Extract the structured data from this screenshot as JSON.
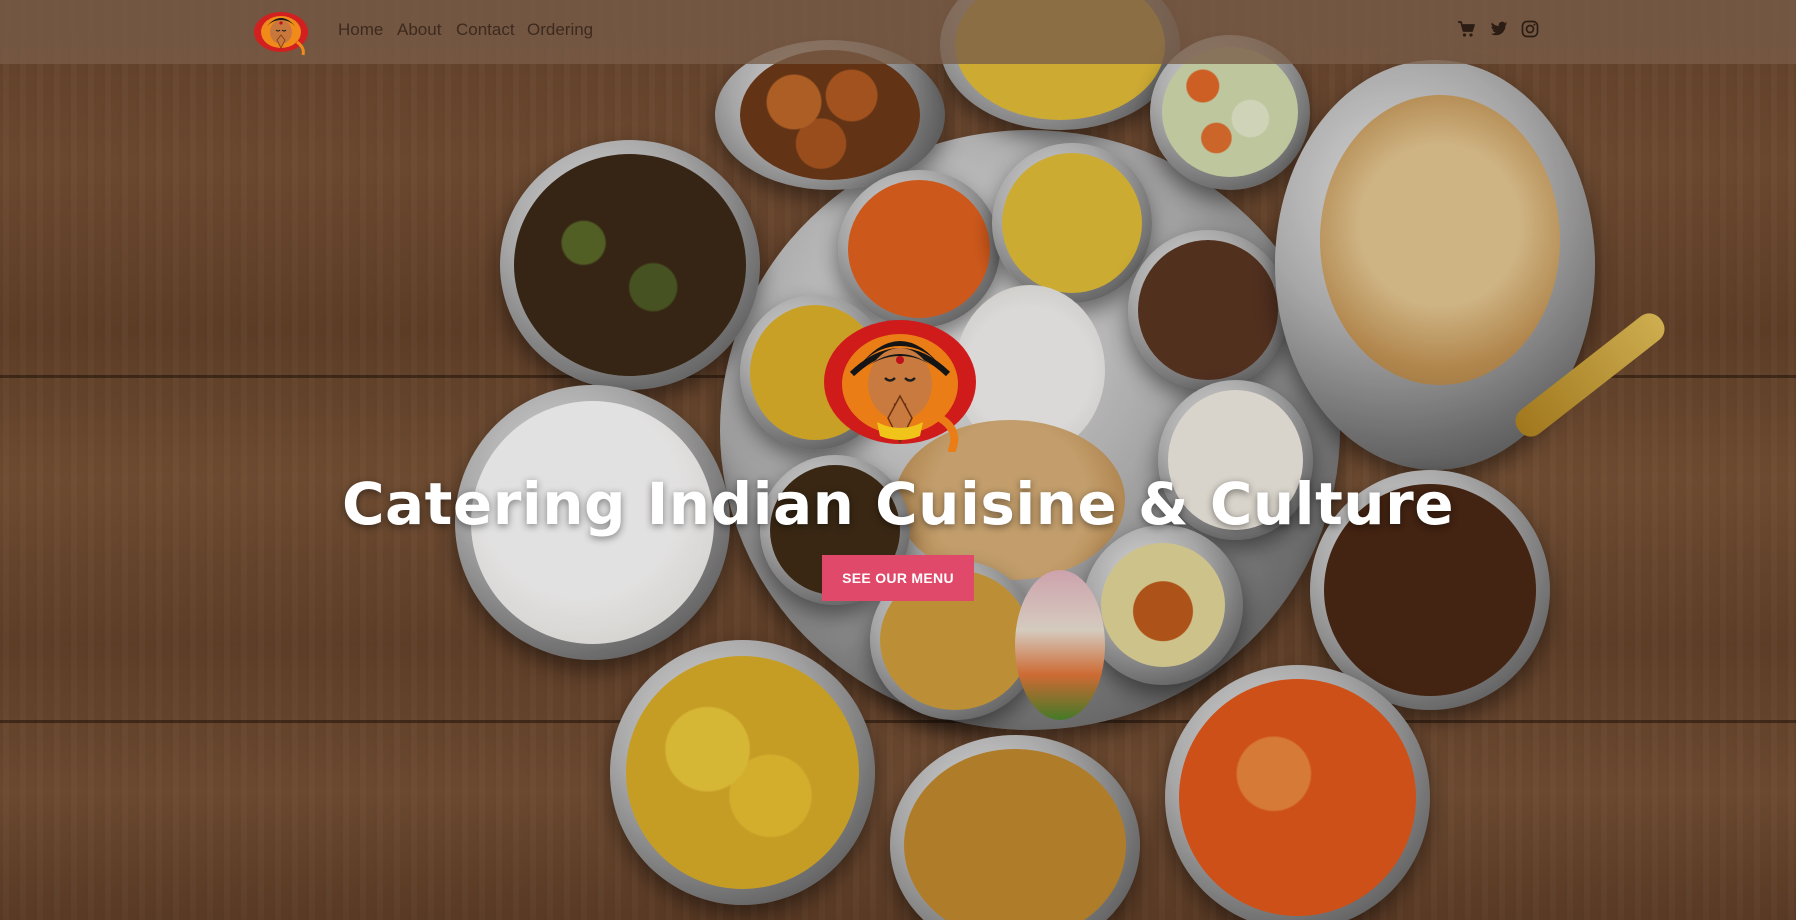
{
  "nav": {
    "logo_icon": "woman-namaste-logo-icon",
    "links": [
      {
        "label": "Home"
      },
      {
        "label": "About"
      },
      {
        "label": "Contact"
      },
      {
        "label": "Ordering"
      }
    ],
    "icons": [
      "cart-icon",
      "twitter-icon",
      "instagram-icon"
    ]
  },
  "hero": {
    "logo_icon": "woman-namaste-logo-icon",
    "title": "Catering Indian Cuisine & Culture",
    "cta_label": "SEE OUR MENU",
    "background_image": "indian-thali-food-spread-on-wooden-table"
  },
  "colors": {
    "cta": "#e0496a",
    "navbar": "#785c48",
    "nav_text": "#3d2a1e",
    "title": "#ffffff"
  }
}
